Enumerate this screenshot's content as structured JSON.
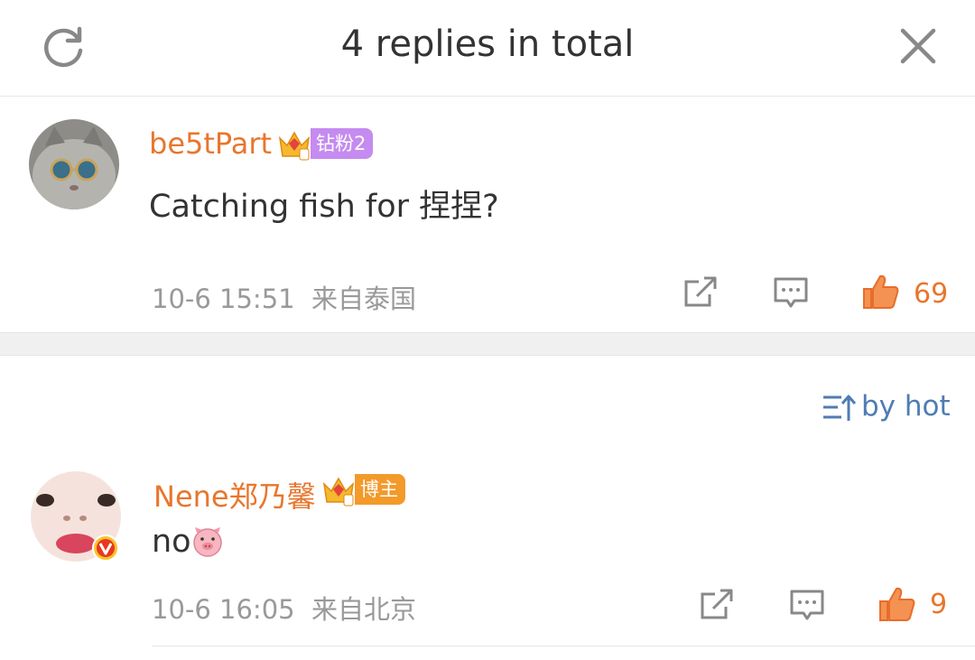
{
  "header": {
    "title": "4 replies in total",
    "refresh_icon": "refresh-icon",
    "close_icon": "close-icon"
  },
  "main_comment": {
    "username": "be5tPart",
    "badge": "钻粉2",
    "badge_color": "#c58bf0",
    "text": "Catching fish for 捏捏?",
    "time": "10-6 15:51",
    "location": "来自泰国",
    "likes": "69"
  },
  "sort": {
    "label": "by hot",
    "icon": "sort-icon"
  },
  "reply": {
    "username": "Nene郑乃馨",
    "badge": "博主",
    "badge_color": "#f39a2b",
    "text": "no",
    "emoji": "pig-face",
    "time": "10-6 16:05",
    "location": "来自北京",
    "likes": "9"
  },
  "colors": {
    "username": "#e8762d",
    "like": "#e8762d",
    "link": "#4f7cb3",
    "meta": "#999999"
  }
}
